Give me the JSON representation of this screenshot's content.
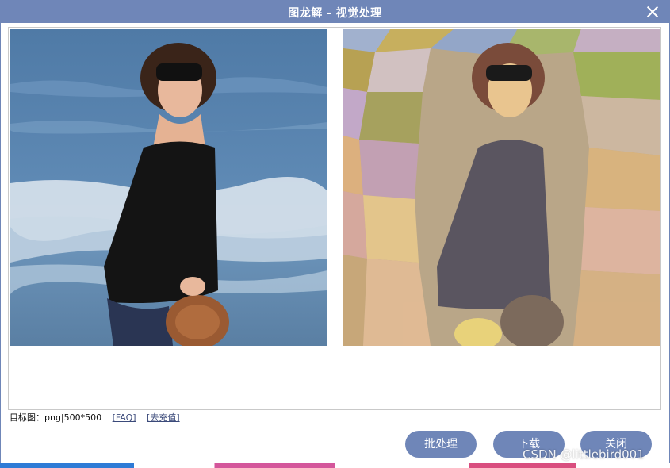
{
  "window": {
    "title": "图龙解 - 视觉处理",
    "close_icon": "close-icon"
  },
  "info": {
    "target_label": "目标图：png|500*500",
    "faq_link": "[FAQ]",
    "recharge_link": "[去充值]"
  },
  "buttons": {
    "batch": "批处理",
    "download": "下载",
    "close": "关闭"
  },
  "watermark": "CSDN @littlebird001",
  "colors": {
    "titlebar": "#6f86b8",
    "button": "#6f86b8"
  }
}
